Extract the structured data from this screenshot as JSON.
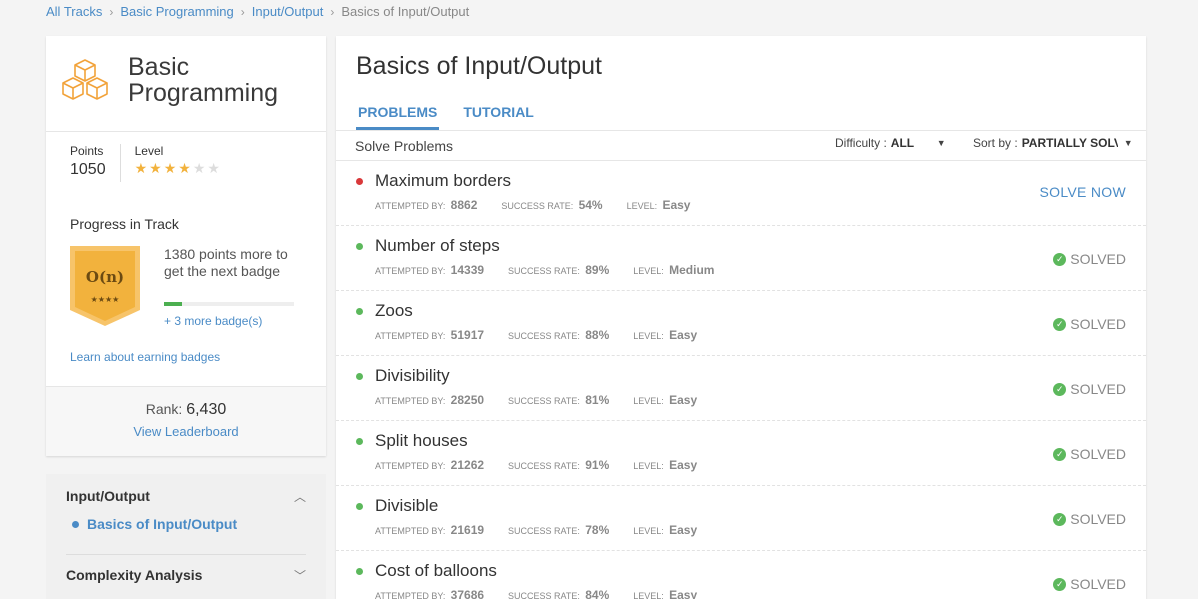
{
  "breadcrumb": [
    "All Tracks",
    "Basic Programming",
    "Input/Output",
    "Basics of Input/Output"
  ],
  "track": {
    "title": "Basic Programming",
    "points_label": "Points",
    "points": "1050",
    "level_label": "Level",
    "level_stars": 4,
    "level_stars_total": 6
  },
  "progress": {
    "title": "Progress in Track",
    "badge_label": "O(n)",
    "badge_stars": "★★★★",
    "message": "1380 points more to get the next badge",
    "fraction": 0.14,
    "more_badges": "+ 3 more badge(s)",
    "learn_link": "Learn about earning badges"
  },
  "rank": {
    "label": "Rank:",
    "value": "6,430",
    "leaderboard_link": "View Leaderboard"
  },
  "nav": {
    "section1": "Input/Output",
    "section1_item": "Basics of Input/Output",
    "section2": "Complexity Analysis"
  },
  "main": {
    "title": "Basics of Input/Output",
    "tabs": [
      "PROBLEMS",
      "TUTORIAL"
    ],
    "solve_label": "Solve Problems",
    "difficulty_label": "Difficulty :",
    "difficulty_value": "ALL",
    "sort_label": "Sort by :",
    "sort_value": "PARTIALLY SOLVED"
  },
  "meta_labels": {
    "attempted": "ATTEMPTED BY:",
    "success": "SUCCESS RATE:",
    "level": "LEVEL:"
  },
  "problems": [
    {
      "name": "Maximum borders",
      "attempted": "8862",
      "success": "54%",
      "level": "Easy",
      "status": "SOLVE NOW",
      "solved": false,
      "dot_color": "#d9383a"
    },
    {
      "name": "Number of steps",
      "attempted": "14339",
      "success": "89%",
      "level": "Medium",
      "status": "SOLVED",
      "solved": true,
      "dot_color": "#5cb85c"
    },
    {
      "name": "Zoos",
      "attempted": "51917",
      "success": "88%",
      "level": "Easy",
      "status": "SOLVED",
      "solved": true,
      "dot_color": "#5cb85c"
    },
    {
      "name": "Divisibility",
      "attempted": "28250",
      "success": "81%",
      "level": "Easy",
      "status": "SOLVED",
      "solved": true,
      "dot_color": "#5cb85c"
    },
    {
      "name": "Split houses",
      "attempted": "21262",
      "success": "91%",
      "level": "Easy",
      "status": "SOLVED",
      "solved": true,
      "dot_color": "#5cb85c"
    },
    {
      "name": "Divisible",
      "attempted": "21619",
      "success": "78%",
      "level": "Easy",
      "status": "SOLVED",
      "solved": true,
      "dot_color": "#5cb85c"
    },
    {
      "name": "Cost of balloons",
      "attempted": "37686",
      "success": "84%",
      "level": "Easy",
      "status": "SOLVED",
      "solved": true,
      "dot_color": "#5cb85c"
    }
  ],
  "colors": {
    "accent": "#4a8bc6",
    "badge": "#f2b23d",
    "solved": "#5cb85c",
    "unsolved_dot": "#d9383a"
  },
  "icons": {
    "track": "cubes-icon",
    "solved": "check-circle-icon",
    "dropdown": "caret-down-icon",
    "expanded": "chevron-up-icon",
    "collapsed": "chevron-down-icon"
  }
}
